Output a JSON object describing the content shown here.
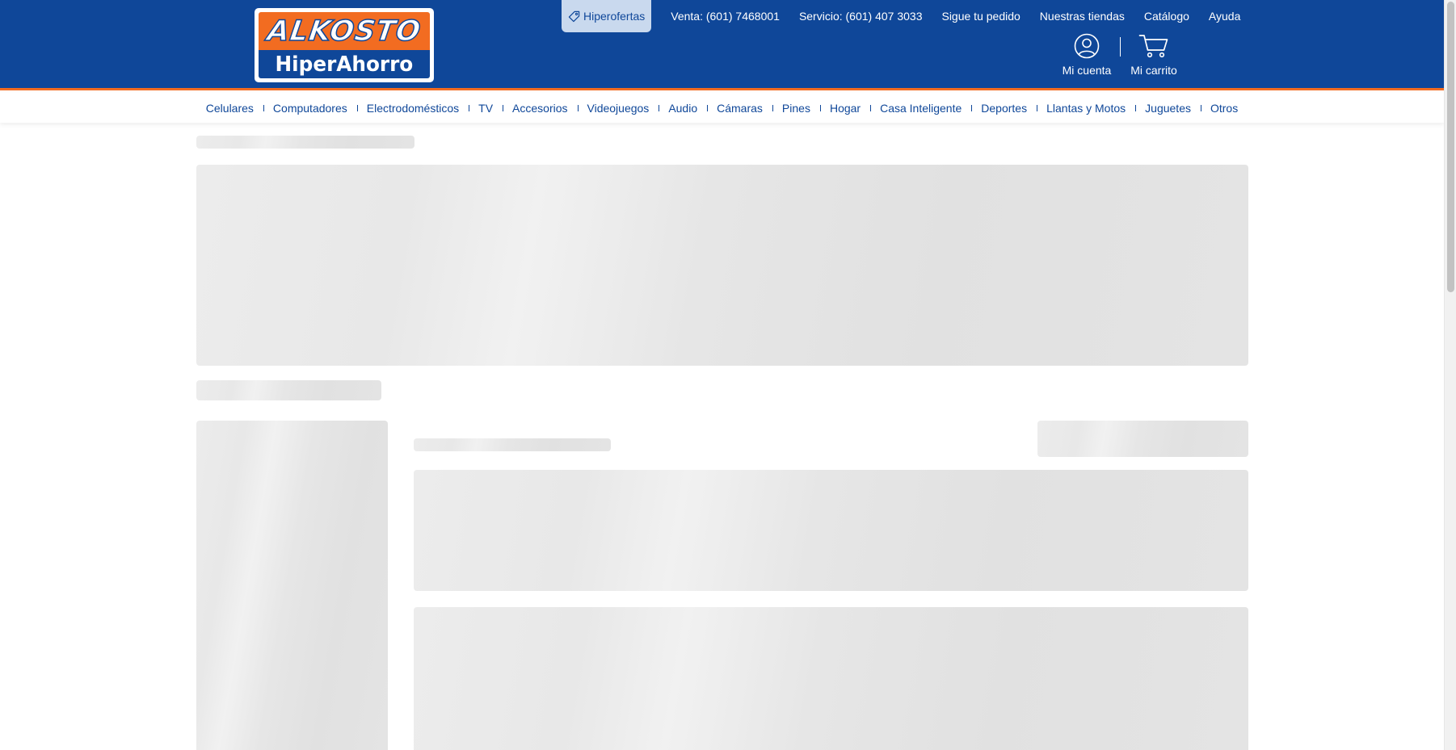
{
  "header": {
    "logo": {
      "line1": "ALKOSTO",
      "line2": "HiperAhorro"
    },
    "promo": {
      "label": "Hiperofertas",
      "icon": "tag-icon"
    },
    "top_links": [
      "Venta: (601) 7468001",
      "Servicio: (601) 407 3033",
      "Sigue tu pedido",
      "Nuestras tiendas",
      "Catálogo",
      "Ayuda"
    ],
    "account": {
      "label": "Mi cuenta",
      "icon": "user-circle-icon"
    },
    "cart": {
      "label": "Mi carrito",
      "icon": "cart-icon"
    }
  },
  "categories": [
    "Celulares",
    "Computadores",
    "Electrodomésticos",
    "TV",
    "Accesorios",
    "Videojuegos",
    "Audio",
    "Cámaras",
    "Pines",
    "Hogar",
    "Casa Inteligente",
    "Deportes",
    "Llantas y Motos",
    "Juguetes",
    "Otros"
  ],
  "colors": {
    "brand_blue": "#0f4799",
    "brand_orange": "#f26c21",
    "promo_bg": "#c9d9ee",
    "skeleton": "#e6e6e6"
  }
}
